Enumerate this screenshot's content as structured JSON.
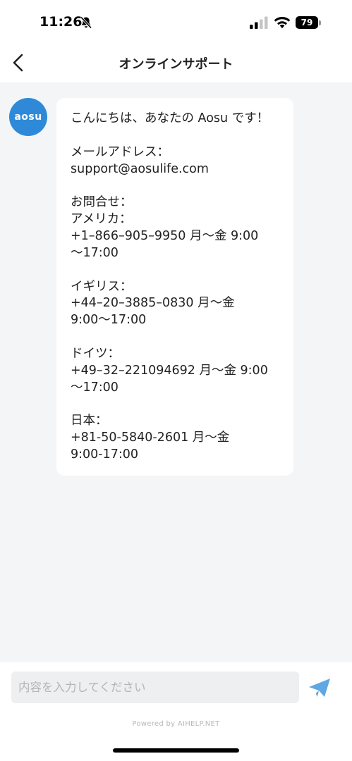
{
  "status_bar": {
    "time": "11:26",
    "battery": "79",
    "icons": [
      "bell-off-icon",
      "cellular-signal-icon",
      "wifi-icon",
      "battery-icon"
    ]
  },
  "nav": {
    "title": "オンラインサポート",
    "back_icon": "chevron-left-icon"
  },
  "chat": {
    "avatar_text": "aosu",
    "avatar_color": "#2e8ad8",
    "message": {
      "greeting": "こんにちは、あなたの Aosu です！",
      "email_label": "メールアドレス：",
      "email": "support@aosulife.com",
      "inquiry_label": "お問合せ：",
      "regions": [
        {
          "name": "アメリカ：",
          "lines": [
            "+1–866–905–9950 月〜金 9:00",
            "〜17:00"
          ]
        },
        {
          "name": "イギリス：",
          "lines": [
            "+44–20–3885–0830 月〜金",
            "9:00〜17:00"
          ]
        },
        {
          "name": "ドイツ：",
          "lines": [
            "+49–32–221094692 月〜金 9:00",
            "〜17:00"
          ]
        },
        {
          "name": "日本：",
          "lines": [
            "+81-50-5840-2601 月〜金",
            "9:00-17:00"
          ]
        }
      ]
    }
  },
  "input": {
    "placeholder": "内容を入力してください",
    "send_icon": "send-icon",
    "send_color": "#5ea7e2"
  },
  "footer": {
    "powered_by": "Powered by AIHELP.NET"
  }
}
